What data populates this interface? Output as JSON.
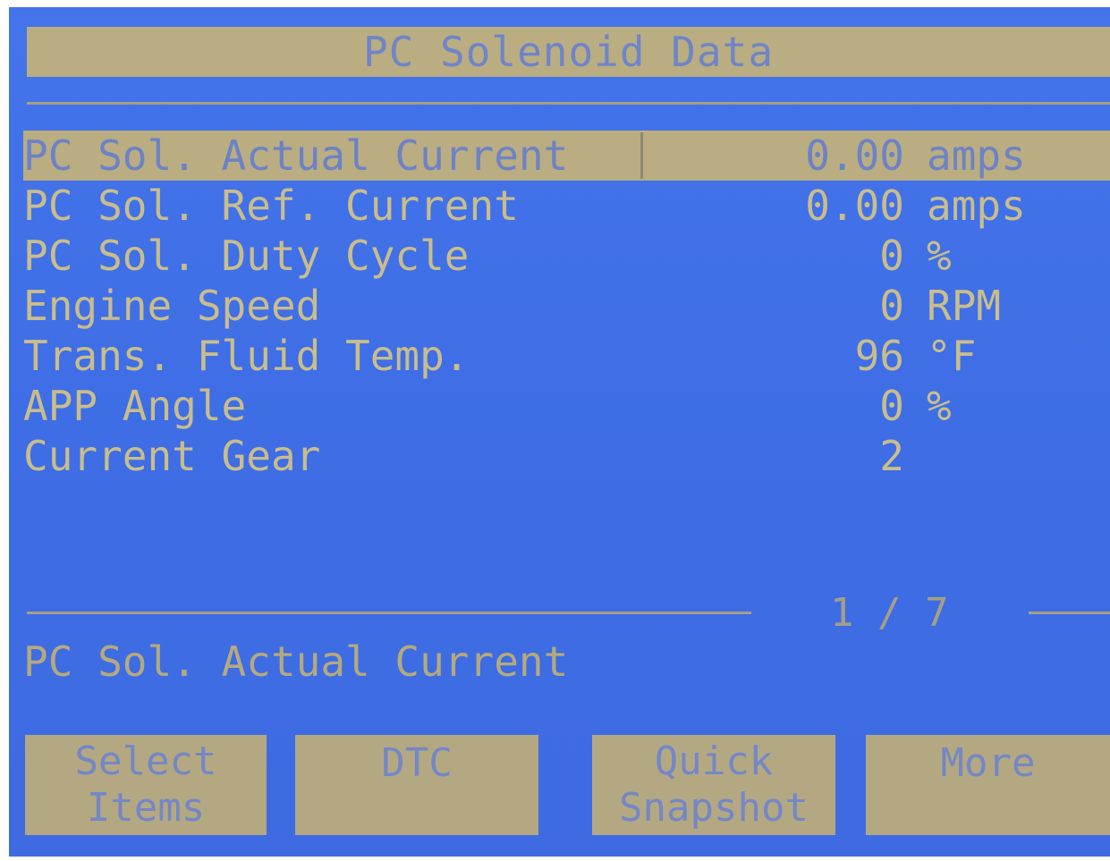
{
  "header": {
    "title": "PC Solenoid Data"
  },
  "data_list": {
    "rows": [
      {
        "label": "PC Sol. Actual Current",
        "value": "0.00",
        "unit": "amps",
        "selected": true
      },
      {
        "label": "PC Sol. Ref. Current",
        "value": "0.00",
        "unit": "amps",
        "selected": false
      },
      {
        "label": "PC Sol. Duty Cycle",
        "value": "0",
        "unit": "%",
        "selected": false
      },
      {
        "label": "Engine Speed",
        "value": "0",
        "unit": "RPM",
        "selected": false
      },
      {
        "label": "Trans. Fluid Temp.",
        "value": "96",
        "unit": "°F",
        "selected": false
      },
      {
        "label": "APP Angle",
        "value": "0",
        "unit": "%",
        "selected": false
      },
      {
        "label": "Current Gear",
        "value": "2",
        "unit": "",
        "selected": false
      }
    ]
  },
  "pagination": {
    "text": "1 / 7"
  },
  "description": {
    "text": "PC Sol. Actual Current"
  },
  "softkeys": [
    {
      "label": "Select\nItems"
    },
    {
      "label": "DTC"
    },
    {
      "label": "Quick\nSnapshot"
    },
    {
      "label": "More"
    }
  ],
  "colors": {
    "screen_background": "#3f6ee6",
    "text": "#c9bd8c",
    "highlight_bar": "#b9ad81",
    "highlight_text": "#6d82c6"
  }
}
